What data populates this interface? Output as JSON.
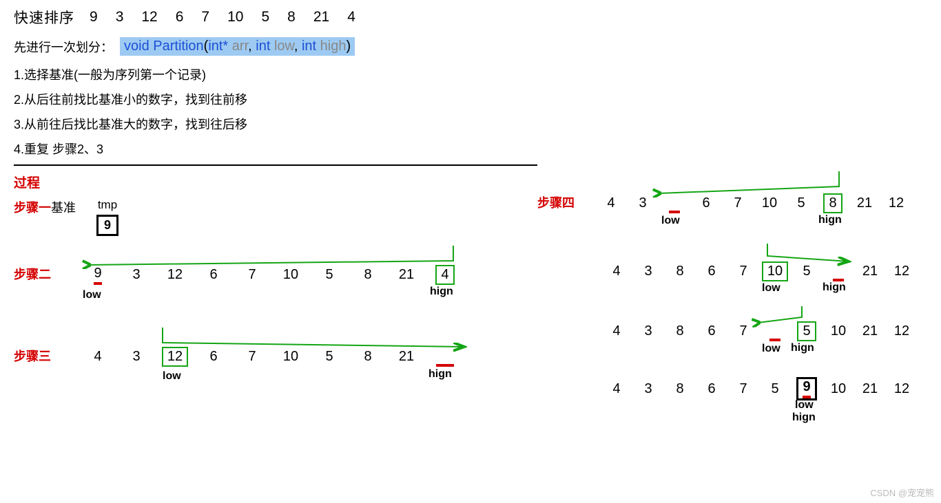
{
  "title": "快速排序",
  "title_nums": [
    "9",
    "3",
    "12",
    "6",
    "7",
    "10",
    "5",
    "8",
    "21",
    "4"
  ],
  "sub": "先进行一次划分：",
  "code": {
    "void": "void",
    "fn": "Partition",
    "open": "(",
    "int1": "int*",
    "arr": "arr",
    "c1": ", ",
    "int2": "int",
    "low": "low",
    "c2": ", ",
    "int3": "int",
    "high": "high",
    "close": ")"
  },
  "rules": {
    "r1": "1.选择基准(一般为序列第一个记录)",
    "r2": "2.从后往前找比基准小的数字，找到往前移",
    "r3": "3.从前往后找比基准大的数字，找到往后移",
    "r4": "4.重复 步骤2、3"
  },
  "process": "过程",
  "steps": {
    "s1_label": "步骤一",
    "s1_base": "基准",
    "s1_tmp": "tmp",
    "s1_val": "9",
    "s2_label": "步骤二",
    "s2_nums": [
      "9",
      "3",
      "12",
      "6",
      "7",
      "10",
      "5",
      "8",
      "21",
      "4"
    ],
    "s3_label": "步骤三",
    "s3_nums": [
      "4",
      "3",
      "12",
      "6",
      "7",
      "10",
      "5",
      "8",
      "21"
    ],
    "s4_label": "步骤四",
    "s4a_nums": [
      "4",
      "3",
      "",
      "6",
      "7",
      "10",
      "5",
      "8",
      "21",
      "12"
    ],
    "s4b_nums": [
      "4",
      "3",
      "8",
      "6",
      "7",
      "10",
      "5",
      "",
      "21",
      "12"
    ],
    "s4c_nums": [
      "4",
      "3",
      "8",
      "6",
      "7",
      "",
      "5",
      "10",
      "21",
      "12"
    ],
    "s4d_nums": [
      "4",
      "3",
      "8",
      "6",
      "7",
      "5",
      "9",
      "10",
      "21",
      "12"
    ]
  },
  "labels": {
    "low": "low",
    "hign": "hign"
  },
  "watermark": "CSDN @宠宠熊"
}
